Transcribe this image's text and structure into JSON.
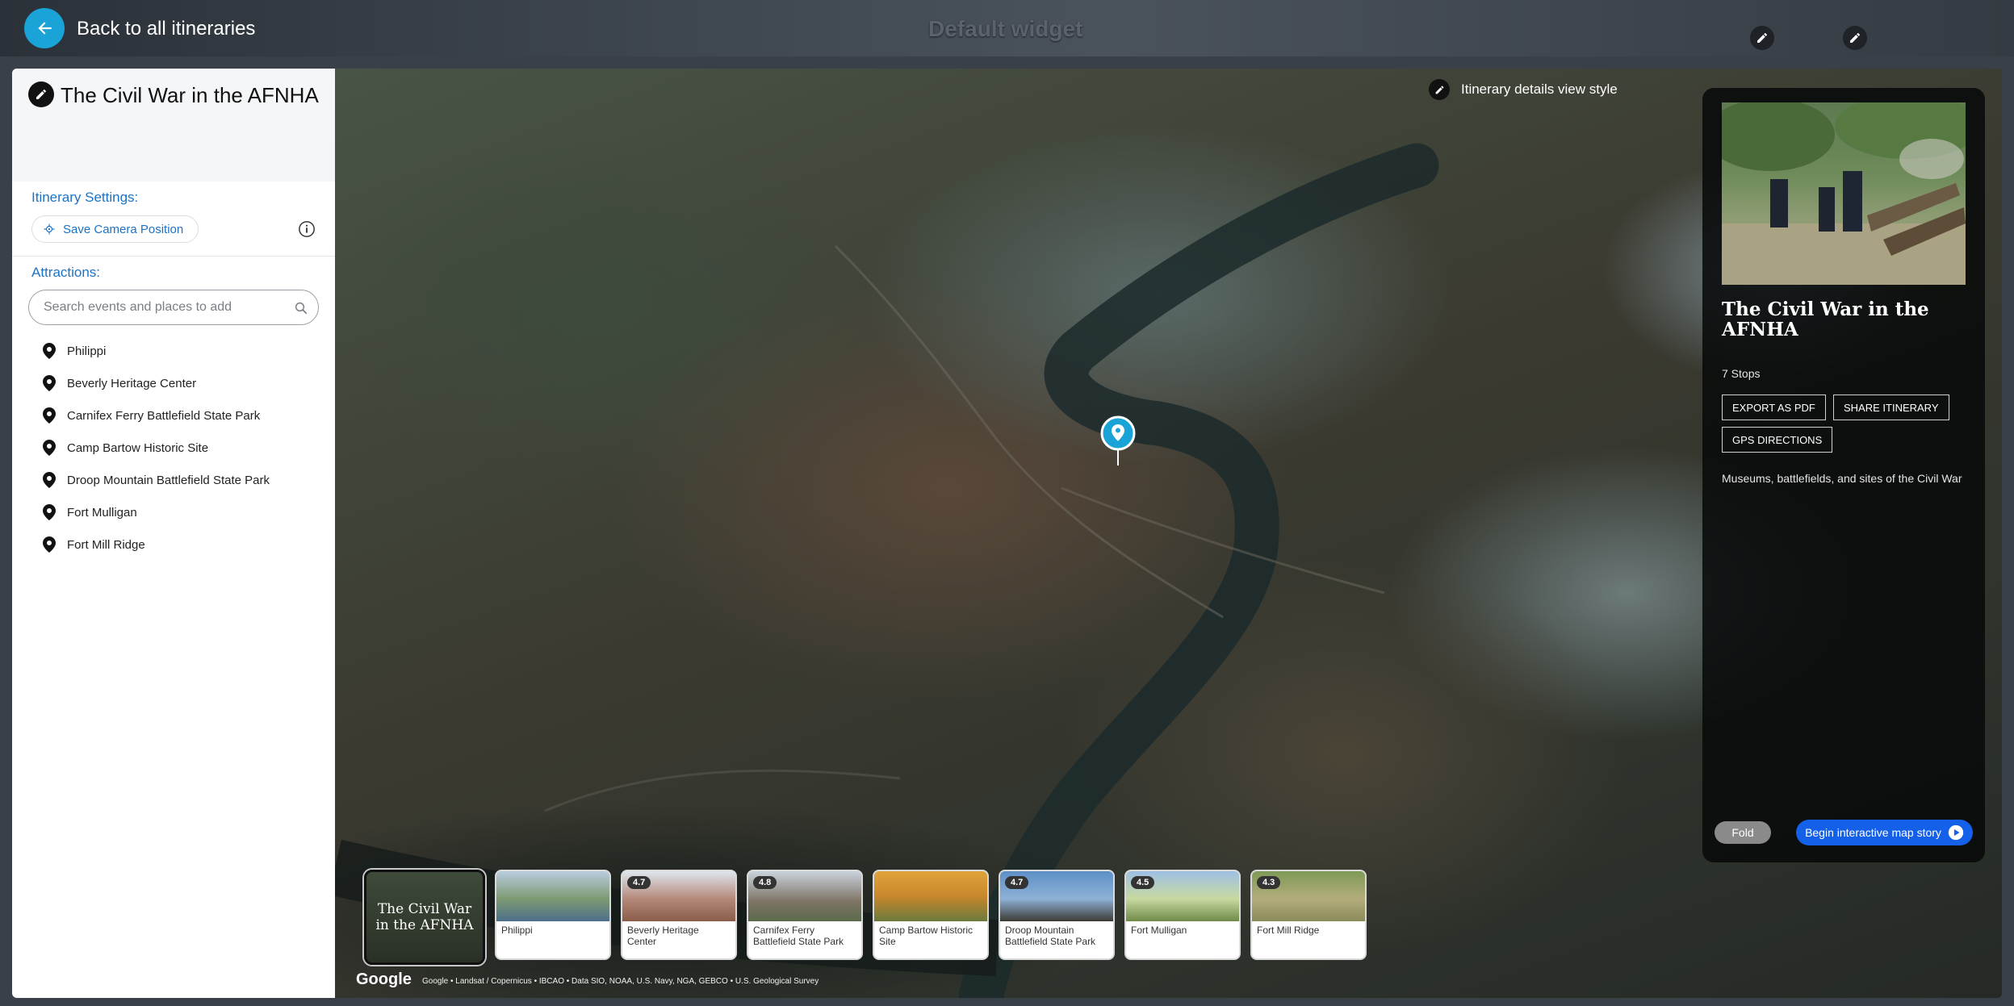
{
  "topbar": {
    "back_label": "Back to all itineraries",
    "widget_title": "Default widget"
  },
  "sidebar": {
    "title": "The Civil War in the AFNHA",
    "settings_label": "Itinerary Settings:",
    "save_camera_label": "Save Camera Position",
    "attractions_label": "Attractions:",
    "search_placeholder": "Search events and places to add",
    "attractions": [
      "Philippi",
      "Beverly Heritage Center",
      "Carnifex Ferry Battlefield State Park",
      "Camp Bartow Historic Site",
      "Droop Mountain Battlefield State Park",
      "Fort Mulligan",
      "Fort Mill Ridge"
    ]
  },
  "map": {
    "view_style_label": "Itinerary details view style",
    "google_label": "Google",
    "attribution": "Google • Landsat / Copernicus • IBCAO • Data SIO, NOAA, U.S. Navy, NGA, GEBCO • U.S. Geological Survey"
  },
  "cards": {
    "cover_title": "The Civil War in the AFNHA",
    "stops": [
      {
        "name": "Philippi",
        "rating": ""
      },
      {
        "name": "Beverly Heritage Center",
        "rating": "4.7"
      },
      {
        "name": "Carnifex Ferry Battlefield State Park",
        "rating": "4.8"
      },
      {
        "name": "Camp Bartow Historic Site",
        "rating": ""
      },
      {
        "name": "Droop Mountain Battlefield State Park",
        "rating": "4.7"
      },
      {
        "name": "Fort Mulligan",
        "rating": "4.5"
      },
      {
        "name": "Fort Mill Ridge",
        "rating": "4.3"
      }
    ]
  },
  "panel": {
    "title": "The Civil War in the AFNHA",
    "stops_count": "7 Stops",
    "export_label": "EXPORT AS PDF",
    "share_label": "SHARE ITINERARY",
    "gps_label": "GPS DIRECTIONS",
    "description": "Museums, battlefields, and sites of the Civil War",
    "fold_label": "Fold",
    "begin_label": "Begin interactive map story"
  },
  "colors": {
    "accent": "#1aa3d6",
    "link": "#1a73c8",
    "primary_button": "#1560e8"
  },
  "icons": [
    "arrow-left-icon",
    "pencil-icon",
    "crosshair-icon",
    "info-icon",
    "search-icon",
    "map-pin-icon",
    "play-circle-icon"
  ]
}
